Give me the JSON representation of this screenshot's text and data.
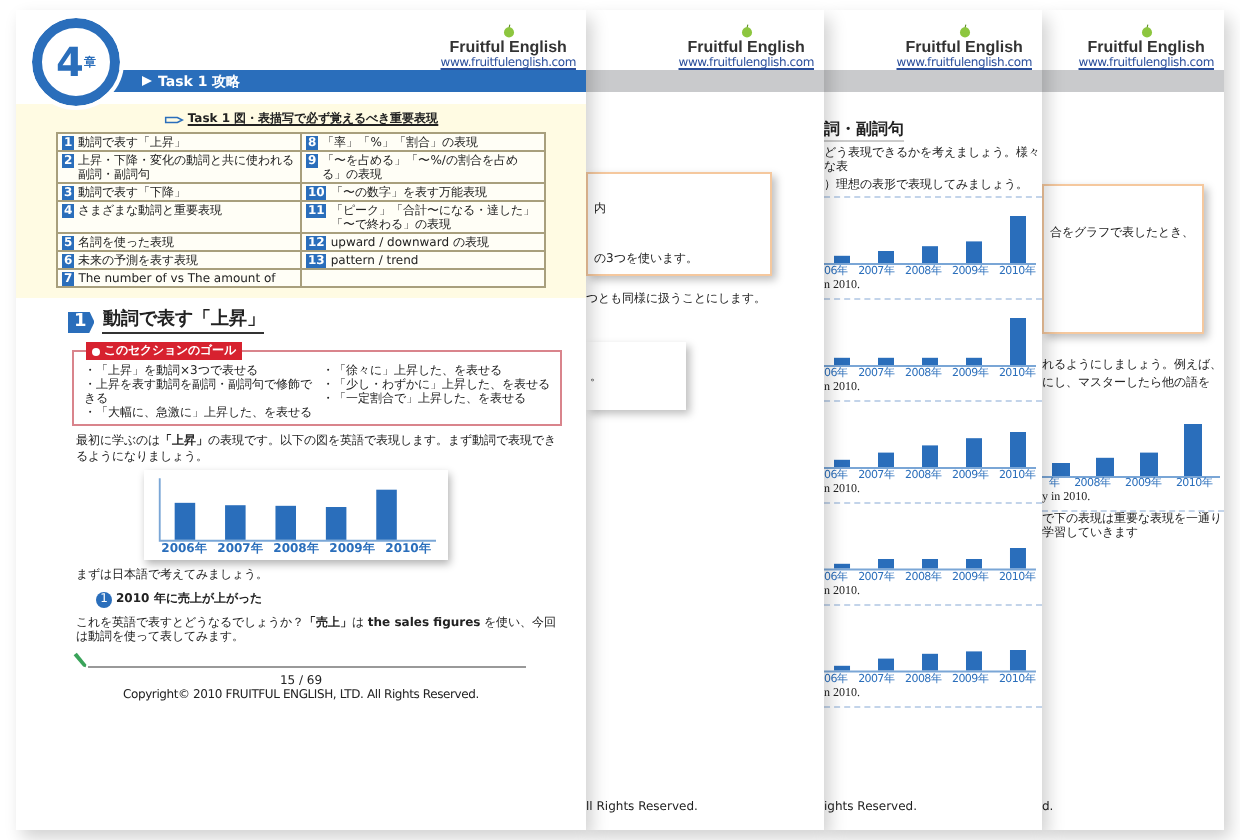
{
  "front_page": {
    "chapter_badge": {
      "number": "4",
      "suffix": "章"
    },
    "brand": {
      "name": "Fruitful English",
      "url": "www.fruitfulenglish.com"
    },
    "header_bar": "Task 1 攻略",
    "summary": {
      "title": "Task 1 図・表描写で必ず覚えるべき重要表現",
      "rows": [
        {
          "left": {
            "number": "1",
            "text": "動詞で表す「上昇」"
          },
          "right": {
            "number": "8",
            "text": "「率」「%」「割合」の表現"
          }
        },
        {
          "left": {
            "number": "2",
            "text": "上昇・下降・変化の動詞と共に使われる副詞・副詞句"
          },
          "right": {
            "number": "9",
            "text": "「〜を占める」「〜%/の割合を占める」の表現"
          }
        },
        {
          "left": {
            "number": "3",
            "text": "動詞で表す「下降」"
          },
          "right": {
            "number": "10",
            "text": "「〜の数字」を表す万能表現"
          }
        },
        {
          "left": {
            "number": "4",
            "text": "さまざまな動詞と重要表現"
          },
          "right": {
            "number": "11",
            "text": "「ピーク」「合計〜になる・達した」「〜で終わる」の表現"
          }
        },
        {
          "left": {
            "number": "5",
            "text": "名詞を使った表現"
          },
          "right": {
            "number": "12",
            "text": "upward / downward の表現"
          }
        },
        {
          "left": {
            "number": "6",
            "text": "未来の予測を表す表現"
          },
          "right": {
            "number": "13",
            "text": "pattern / trend"
          }
        },
        {
          "left": {
            "number": "7",
            "text": "The number of vs The amount of"
          }
        }
      ]
    },
    "section": {
      "number": "1",
      "title": "動詞で表す「上昇」"
    },
    "goal_box": {
      "title": "このセクションのゴール",
      "left": [
        "・「上昇」を動詞×3つで表せる",
        "・上昇を表す動詞を副詞・副詞句で修飾できる",
        "・「大幅に、急激に」上昇した、を表せる"
      ],
      "right": [
        "・「徐々に」上昇した、を表せる",
        "・「少し・わずかに」上昇した、を表せる",
        "・「一定割合で」上昇した、を表せる"
      ]
    },
    "intro": "最初に学ぶのは**「上昇」**の表現です。以下の図を英語で表現します。まず動詞で表現できるようになりましょう。",
    "chart_labels": [
      "2006年",
      "2007年",
      "2008年",
      "2009年",
      "2010年"
    ],
    "note": "まずは日本語で考えてみましょう。",
    "example": {
      "number": "1",
      "text": "2010 年に売上が上がった"
    },
    "question": "これを英語で表すとどうなるでしょうか？**「売上」**は **the sales figures** を使い、今回は動詞を使って表してみます。",
    "page_number": "15 / 69",
    "copyright": "Copyright© 2010 FRUITFUL ENGLISH, LTD. All Rights Reserved."
  },
  "page_2": {
    "brand": {
      "name": "Fruitful English",
      "url": "www.fruitfulenglish.com"
    },
    "box_lines": [
      "内",
      "の3つを使います。"
    ],
    "text": "つとも同様に扱うことにします。",
    "small_box_text": "。",
    "copyright": "ll Rights Reserved."
  },
  "page_3": {
    "brand": {
      "name": "Fruitful English",
      "url": "www.fruitfulenglish.com"
    },
    "heading": "詞・副詞句",
    "intro_lines": [
      "どう表現できるかを考えましょう。様々な表",
      "）理想の表形で表現してみましょう。"
    ],
    "charts": [
      {
        "kind": "jump",
        "labels": [
          "06年",
          "2007年",
          "2008年",
          "2009年",
          "2010年"
        ],
        "caption": "n 2010."
      },
      {
        "kind": "spike",
        "labels": [
          "06年",
          "2007年",
          "2008年",
          "2009年",
          "2010年"
        ],
        "caption": "n 2010."
      },
      {
        "kind": "climb",
        "labels": [
          "06年",
          "2007年",
          "2008年",
          "2009年",
          "2010年"
        ],
        "caption": "n 2010."
      },
      {
        "kind": "bump",
        "labels": [
          "06年",
          "2007年",
          "2008年",
          "2009年",
          "2010年"
        ],
        "caption": "n 2010."
      },
      {
        "kind": "slope",
        "labels": [
          "06年",
          "2007年",
          "2008年",
          "2009年",
          "2010年"
        ],
        "caption": "n 2010."
      }
    ],
    "copyright": "ights Reserved."
  },
  "page_4": {
    "brand": {
      "name": "Fruitful English",
      "url": "www.fruitfulenglish.com"
    },
    "box_text": "合をグラフで表したとき、",
    "lines": [
      "れるようにしましょう。例えば、",
      "にし、マスターしたら他の語を"
    ],
    "chart": {
      "kind": "jump",
      "labels": [
        "年",
        "2008年",
        "2009年",
        "2010年"
      ],
      "caption": "y in 2010."
    },
    "note": "で下の表現は重要な表現を一通り学習していきます",
    "copyright": "d."
  }
}
